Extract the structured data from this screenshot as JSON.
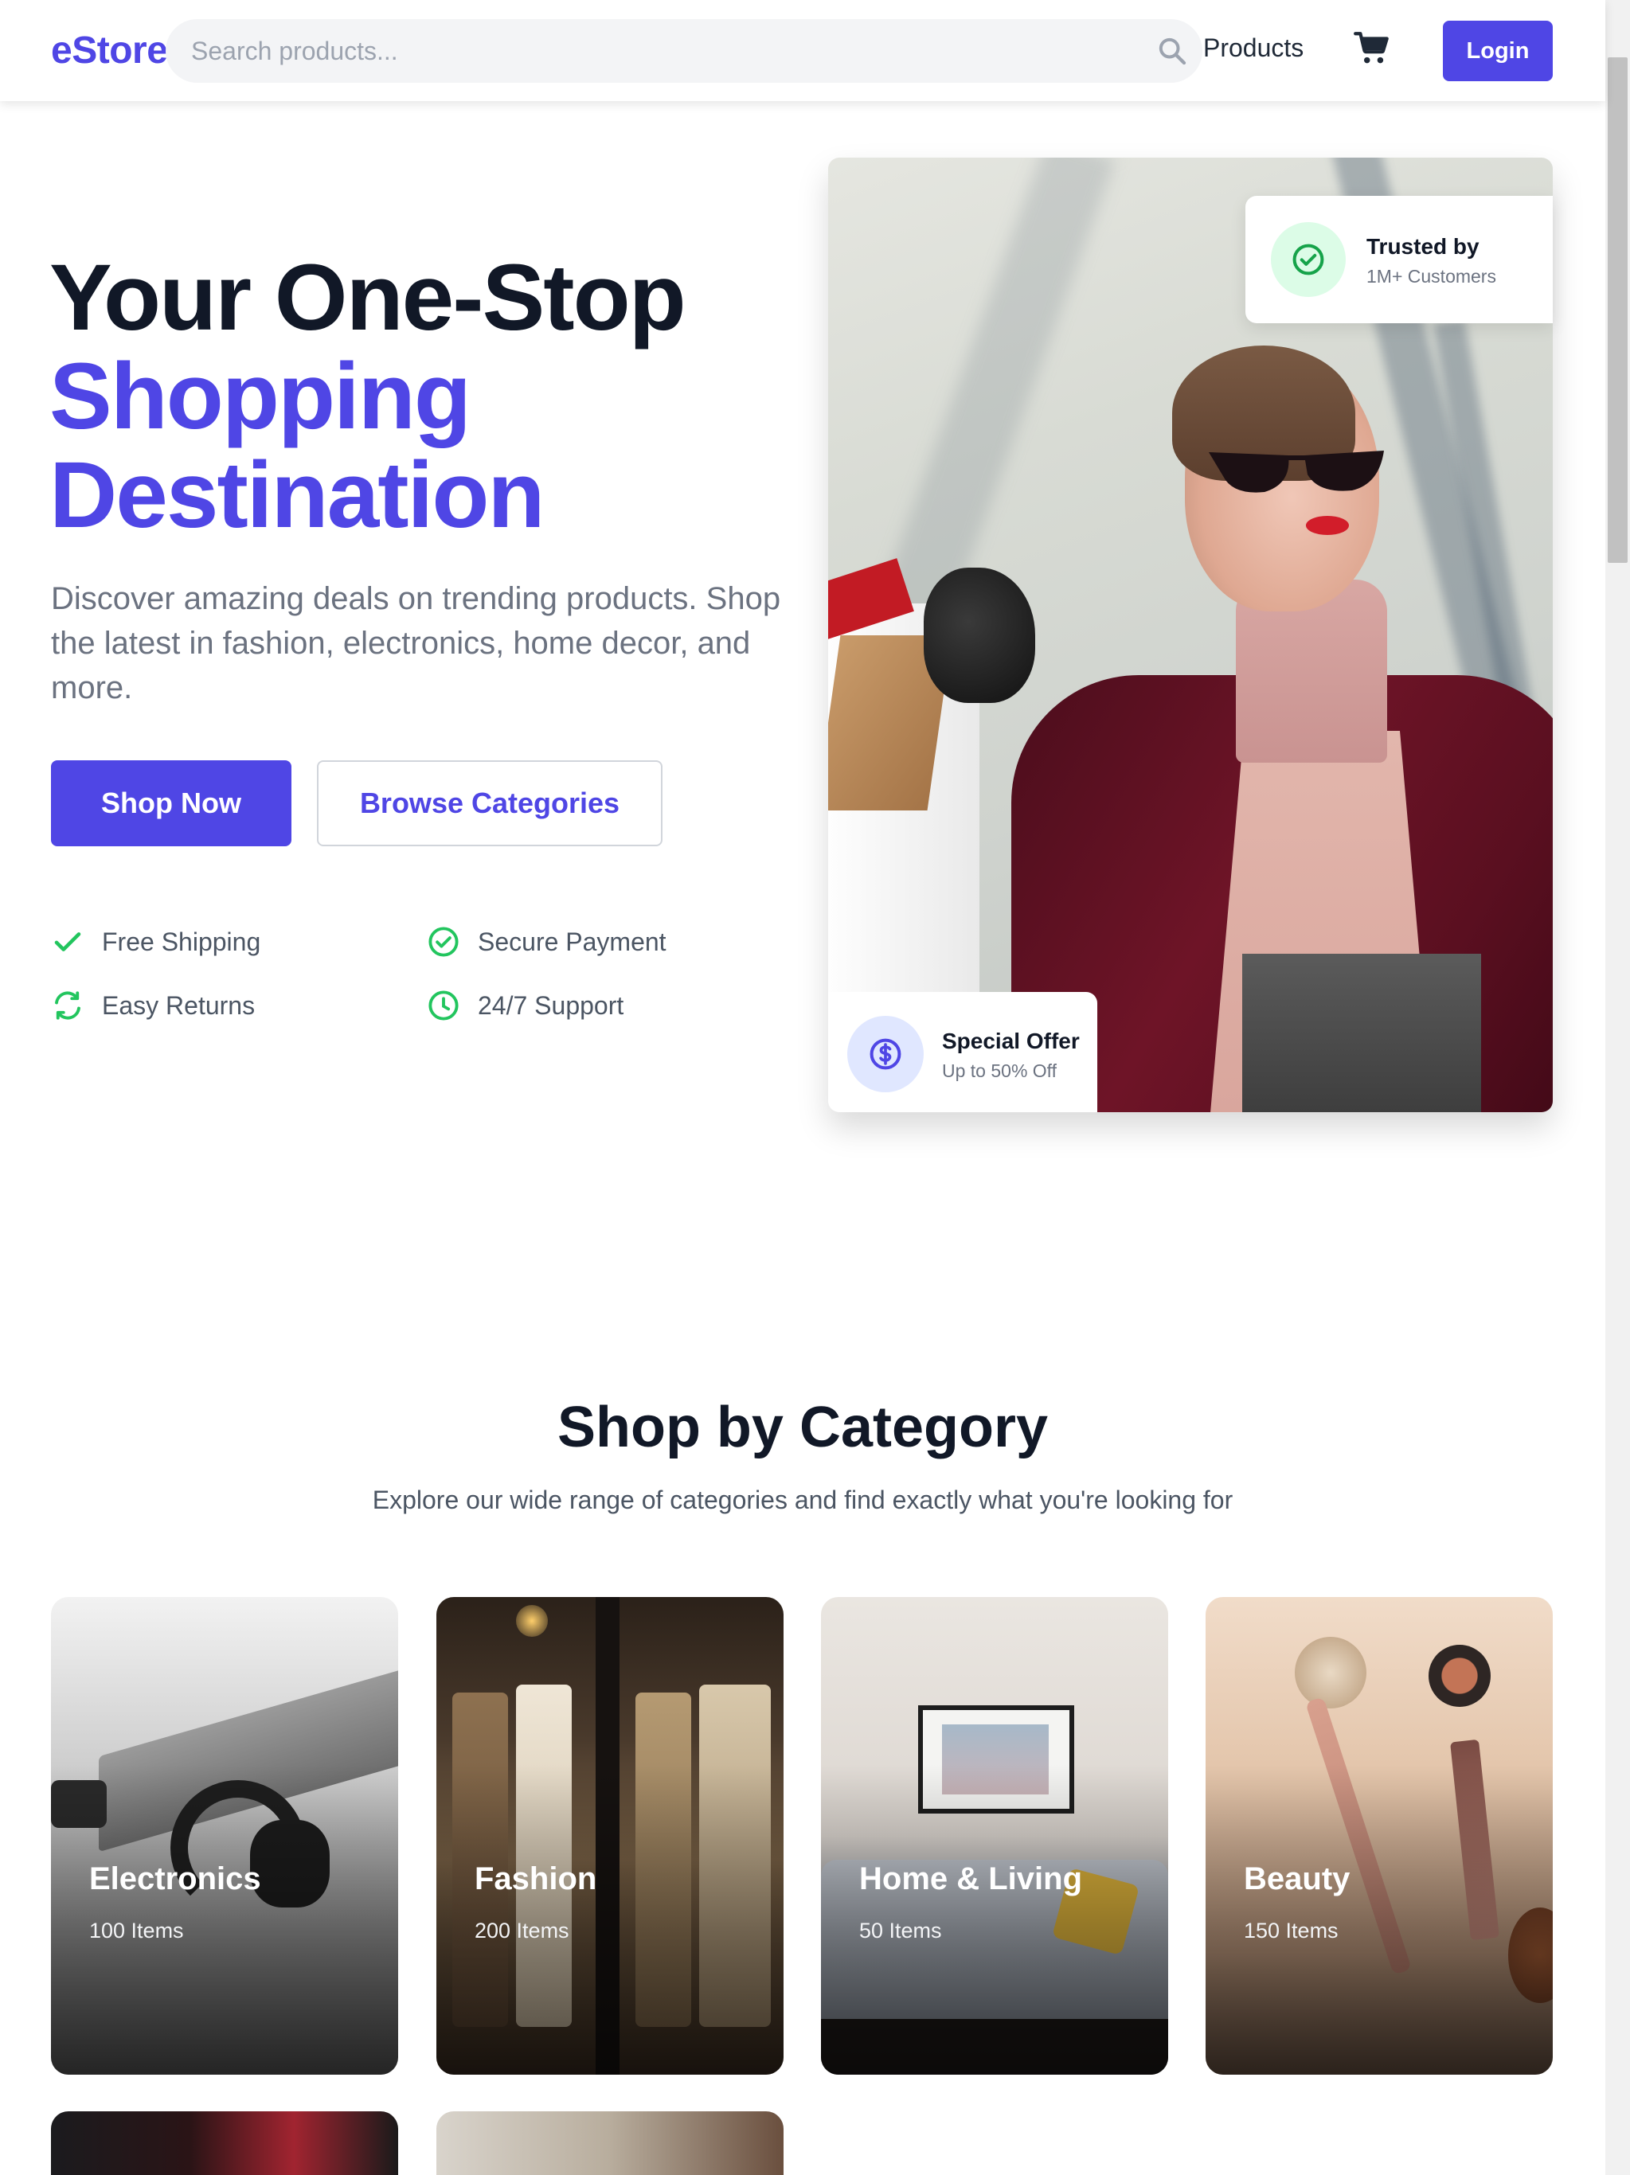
{
  "header": {
    "logo": "eStore",
    "search_placeholder": "Search products...",
    "nav_products": "Products",
    "login_label": "Login"
  },
  "hero": {
    "title_line1": "Your One-Stop",
    "title_line2": "Shopping",
    "title_line3": "Destination",
    "description": "Discover amazing deals on trending products. Shop the latest in fashion, electronics, home decor, and more.",
    "primary_cta": "Shop Now",
    "secondary_cta": "Browse Categories",
    "features": [
      {
        "label": "Free Shipping",
        "icon": "check-icon"
      },
      {
        "label": "Secure Payment",
        "icon": "check-circle-icon"
      },
      {
        "label": "Easy Returns",
        "icon": "refresh-icon"
      },
      {
        "label": "24/7 Support",
        "icon": "clock-icon"
      }
    ],
    "badge_trusted": {
      "title": "Trusted by",
      "subtitle": "1M+ Customers"
    },
    "badge_offer": {
      "title": "Special Offer",
      "subtitle": "Up to 50% Off"
    }
  },
  "categories": {
    "title": "Shop by Category",
    "subtitle": "Explore our wide range of categories and find exactly what you're looking for",
    "items": [
      {
        "name": "Electronics",
        "count": "100 Items"
      },
      {
        "name": "Fashion",
        "count": "200 Items"
      },
      {
        "name": "Home & Living",
        "count": "50 Items"
      },
      {
        "name": "Beauty",
        "count": "150 Items"
      }
    ]
  },
  "colors": {
    "brand": "#4f46e5",
    "success": "#22c55e",
    "text_dark": "#111827",
    "text_muted": "#6b7280"
  }
}
